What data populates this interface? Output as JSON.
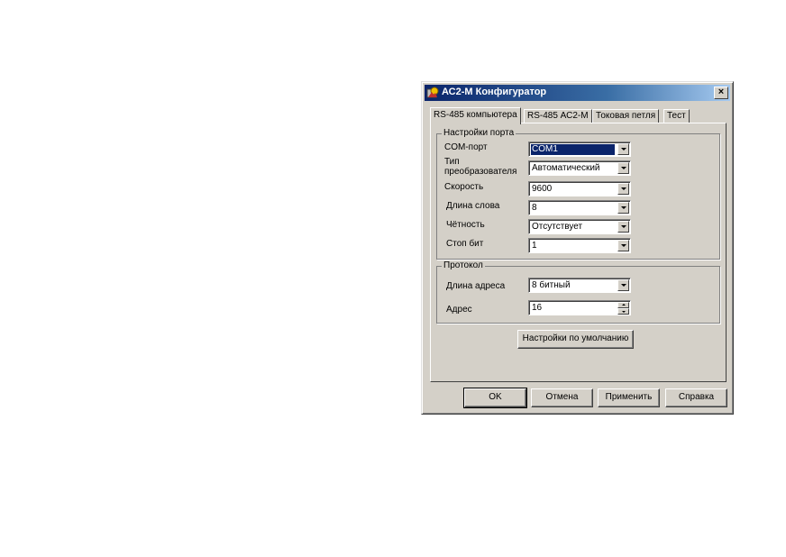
{
  "window": {
    "title": "АС2-М Конфигуратор",
    "close_glyph": "×",
    "icon": "app-settings-icon"
  },
  "tabs": [
    {
      "label": "RS-485 компьютера",
      "active": true
    },
    {
      "label": "RS-485 АС2-М",
      "active": false
    },
    {
      "label": "Токовая петля",
      "active": false
    },
    {
      "label": "Тест",
      "active": false
    }
  ],
  "port_settings": {
    "title": "Настройки порта",
    "com_port": {
      "label": "COM-порт",
      "value": "COM1"
    },
    "converter_type": {
      "label_line1": "Тип",
      "label_line2": "преобразователя",
      "value": "Автоматический"
    },
    "speed": {
      "label": "Скорость",
      "value": "9600"
    },
    "word_length": {
      "label": "Длина слова",
      "value": "8"
    },
    "parity": {
      "label": "Чётность",
      "value": "Отсутствует"
    },
    "stop_bits": {
      "label": "Стоп бит",
      "value": "1"
    }
  },
  "protocol": {
    "title": "Протокол",
    "address_length": {
      "label": "Длина адреса",
      "value": "8 битный"
    },
    "address": {
      "label": "Адрес",
      "value": "16"
    }
  },
  "defaults_button": "Настройки по умолчанию",
  "buttons": {
    "ok": "OK",
    "cancel": "Отмена",
    "apply": "Применить",
    "help": "Справка"
  }
}
